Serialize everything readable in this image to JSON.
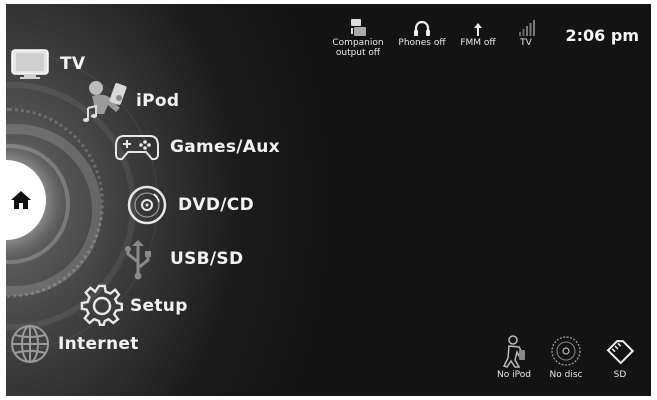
{
  "menu": {
    "home": {
      "icon": "home-icon"
    },
    "items": [
      {
        "id": "tv",
        "label": "TV",
        "icon": "tv-icon"
      },
      {
        "id": "ipod",
        "label": "iPod",
        "icon": "ipod-music-icon"
      },
      {
        "id": "games",
        "label": "Games/Aux",
        "icon": "gamepad-icon"
      },
      {
        "id": "dvd",
        "label": "DVD/CD",
        "icon": "disc-icon"
      },
      {
        "id": "usb",
        "label": "USB/SD",
        "icon": "usb-icon"
      },
      {
        "id": "setup",
        "label": "Setup",
        "icon": "gear-icon"
      },
      {
        "id": "internet",
        "label": "Internet",
        "icon": "globe-icon"
      }
    ]
  },
  "status": {
    "companion": "Companion\noutput off",
    "phones": "Phones off",
    "fmm": "FMM off",
    "tv": "TV",
    "clock": "2:06 pm"
  },
  "media": {
    "ipod": "No iPod",
    "disc": "No disc",
    "sd": "SD"
  },
  "colors": {
    "background": "#131313",
    "text": "#f2f2f2",
    "home_disc": "#ffffff"
  }
}
